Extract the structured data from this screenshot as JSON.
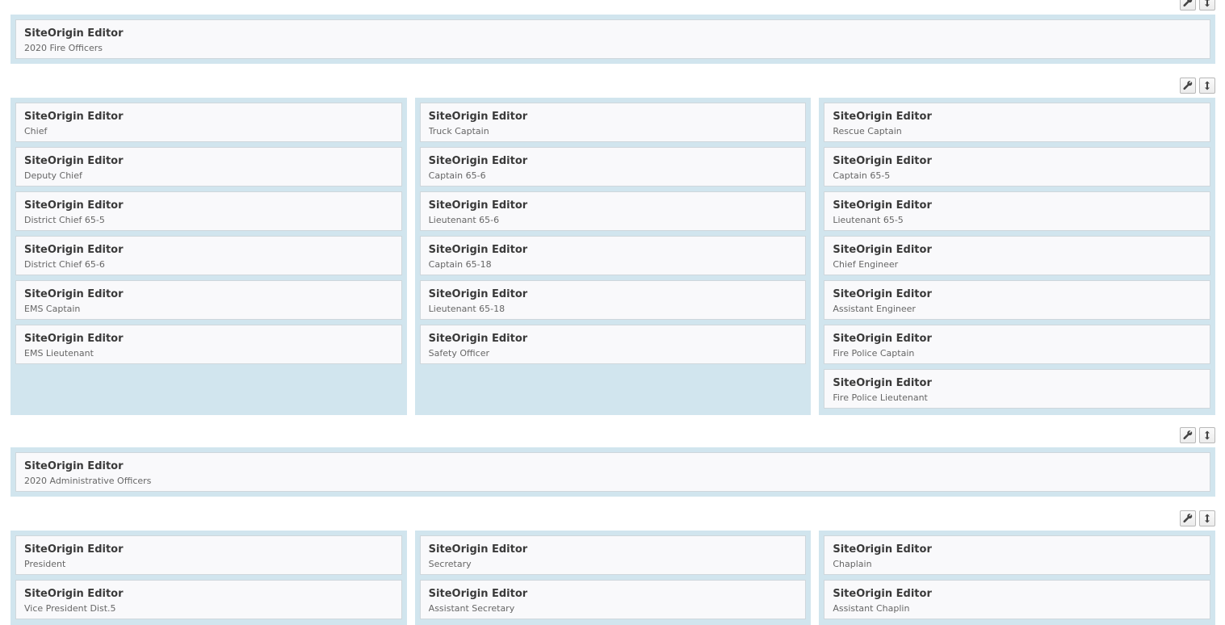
{
  "rows": [
    {
      "cells": [
        {
          "widgets": [
            {
              "title": "SiteOrigin Editor",
              "desc": "2020 Fire Officers"
            }
          ]
        }
      ]
    },
    {
      "cells": [
        {
          "widgets": [
            {
              "title": "SiteOrigin Editor",
              "desc": "Chief"
            },
            {
              "title": "SiteOrigin Editor",
              "desc": "Deputy Chief"
            },
            {
              "title": "SiteOrigin Editor",
              "desc": "District Chief 65-5"
            },
            {
              "title": "SiteOrigin Editor",
              "desc": "District Chief 65-6"
            },
            {
              "title": "SiteOrigin Editor",
              "desc": "EMS Captain"
            },
            {
              "title": "SiteOrigin Editor",
              "desc": "EMS Lieutenant"
            }
          ]
        },
        {
          "widgets": [
            {
              "title": "SiteOrigin Editor",
              "desc": "Truck Captain"
            },
            {
              "title": "SiteOrigin Editor",
              "desc": "Captain 65-6"
            },
            {
              "title": "SiteOrigin Editor",
              "desc": "Lieutenant 65-6"
            },
            {
              "title": "SiteOrigin Editor",
              "desc": "Captain 65-18"
            },
            {
              "title": "SiteOrigin Editor",
              "desc": "Lieutenant 65-18"
            },
            {
              "title": "SiteOrigin Editor",
              "desc": "Safety Officer"
            }
          ]
        },
        {
          "widgets": [
            {
              "title": "SiteOrigin Editor",
              "desc": "Rescue Captain"
            },
            {
              "title": "SiteOrigin Editor",
              "desc": "Captain 65-5"
            },
            {
              "title": "SiteOrigin Editor",
              "desc": "Lieutenant 65-5"
            },
            {
              "title": "SiteOrigin Editor",
              "desc": "Chief Engineer"
            },
            {
              "title": "SiteOrigin Editor",
              "desc": "Assistant Engineer"
            },
            {
              "title": "SiteOrigin Editor",
              "desc": "Fire Police Captain"
            },
            {
              "title": "SiteOrigin Editor",
              "desc": "Fire Police Lieutenant"
            }
          ]
        }
      ]
    },
    {
      "cells": [
        {
          "widgets": [
            {
              "title": "SiteOrigin Editor",
              "desc": "2020 Administrative Officers"
            }
          ]
        }
      ]
    },
    {
      "cells": [
        {
          "widgets": [
            {
              "title": "SiteOrigin Editor",
              "desc": "President"
            },
            {
              "title": "SiteOrigin Editor",
              "desc": "Vice President Dist.5"
            }
          ]
        },
        {
          "widgets": [
            {
              "title": "SiteOrigin Editor",
              "desc": "Secretary"
            },
            {
              "title": "SiteOrigin Editor",
              "desc": "Assistant Secretary"
            }
          ]
        },
        {
          "widgets": [
            {
              "title": "SiteOrigin Editor",
              "desc": "Chaplain"
            },
            {
              "title": "SiteOrigin Editor",
              "desc": "Assistant Chaplin"
            }
          ]
        }
      ]
    }
  ],
  "icons": {
    "row_edit": "wrench-icon",
    "row_move": "move-vertical-icon"
  },
  "colors": {
    "cell_background": "#d1e5ee",
    "widget_background": "#f9f9fb"
  }
}
